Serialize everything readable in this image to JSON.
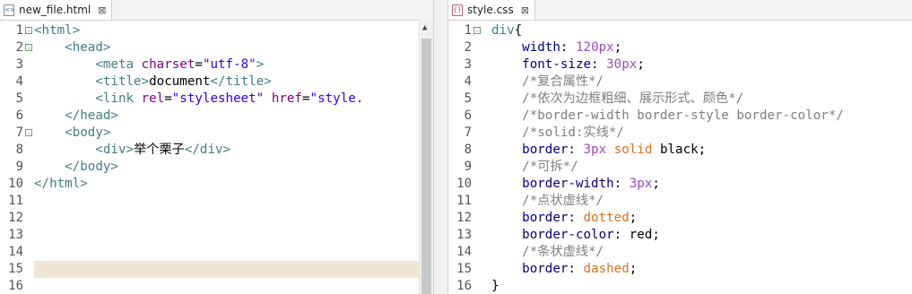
{
  "left_pane": {
    "tab_label": "new_file.html",
    "tab_icon": "html-file-icon",
    "close_glyph": "⊠",
    "line_numbers": [
      "1",
      "2",
      "3",
      "4",
      "5",
      "6",
      "7",
      "8",
      "9",
      "10",
      "11",
      "12",
      "13",
      "14",
      "15",
      "16"
    ],
    "fold_markers": {
      "1": "⊟",
      "2": "⊟",
      "7": "⊟"
    },
    "current_line": 15,
    "lines": [
      [
        [
          "tag",
          "<html>"
        ]
      ],
      [
        [
          "plain",
          "    "
        ],
        [
          "tag",
          "<head>"
        ]
      ],
      [
        [
          "plain",
          "        "
        ],
        [
          "tag",
          "<meta "
        ],
        [
          "attr",
          "charset"
        ],
        [
          "plain",
          "="
        ],
        [
          "str",
          "\"utf-8\""
        ],
        [
          "tag",
          ">"
        ]
      ],
      [
        [
          "plain",
          "        "
        ],
        [
          "tag",
          "<title>"
        ],
        [
          "plain",
          "document"
        ],
        [
          "tag",
          "</title>"
        ]
      ],
      [
        [
          "plain",
          "        "
        ],
        [
          "tag",
          "<link "
        ],
        [
          "attr",
          "rel"
        ],
        [
          "plain",
          "="
        ],
        [
          "str",
          "\"stylesheet\""
        ],
        [
          "plain",
          " "
        ],
        [
          "attr",
          "href"
        ],
        [
          "plain",
          "="
        ],
        [
          "str",
          "\"style."
        ]
      ],
      [
        [
          "plain",
          "    "
        ],
        [
          "tag",
          "</head>"
        ]
      ],
      [
        [
          "plain",
          "    "
        ],
        [
          "tag",
          "<body>"
        ]
      ],
      [
        [
          "plain",
          "        "
        ],
        [
          "tag",
          "<div>"
        ],
        [
          "plain",
          "举个栗子"
        ],
        [
          "tag",
          "</div>"
        ]
      ],
      [
        [
          "plain",
          "    "
        ],
        [
          "tag",
          "</body>"
        ]
      ],
      [
        [
          "tag",
          "</html>"
        ]
      ],
      [],
      [],
      [],
      [],
      [],
      []
    ]
  },
  "right_pane": {
    "tab_label": "style.css",
    "tab_icon": "css-file-icon",
    "close_glyph": "⊠",
    "line_numbers": [
      "1",
      "2",
      "3",
      "4",
      "5",
      "6",
      "7",
      "8",
      "9",
      "10",
      "11",
      "12",
      "13",
      "14",
      "15",
      "16"
    ],
    "fold_markers": {
      "1": "⊟"
    },
    "lines": [
      [
        [
          "sel",
          "div"
        ],
        [
          "plain",
          "{"
        ]
      ],
      [
        [
          "plain",
          "    "
        ],
        [
          "prop",
          "width"
        ],
        [
          "plain",
          ": "
        ],
        [
          "num",
          "120px"
        ],
        [
          "plain",
          ";"
        ]
      ],
      [
        [
          "plain",
          "    "
        ],
        [
          "prop",
          "font-size"
        ],
        [
          "plain",
          ": "
        ],
        [
          "num",
          "30px"
        ],
        [
          "plain",
          ";"
        ]
      ],
      [
        [
          "plain",
          "    "
        ],
        [
          "cmt",
          "/*复合属性*/"
        ]
      ],
      [
        [
          "plain",
          "    "
        ],
        [
          "cmt",
          "/*依次为边框粗细、展示形式、颜色*/"
        ]
      ],
      [
        [
          "plain",
          "    "
        ],
        [
          "cmt",
          "/*border-width border-style border-color*/"
        ]
      ],
      [
        [
          "plain",
          "    "
        ],
        [
          "cmt",
          "/*solid:实线*/"
        ]
      ],
      [
        [
          "plain",
          "    "
        ],
        [
          "prop",
          "border"
        ],
        [
          "plain",
          ": "
        ],
        [
          "num",
          "3px"
        ],
        [
          "plain",
          " "
        ],
        [
          "kw",
          "solid"
        ],
        [
          "plain",
          " black;"
        ]
      ],
      [
        [
          "plain",
          "    "
        ],
        [
          "cmt",
          "/*可拆*/"
        ]
      ],
      [
        [
          "plain",
          "    "
        ],
        [
          "prop",
          "border-width"
        ],
        [
          "plain",
          ": "
        ],
        [
          "num",
          "3px"
        ],
        [
          "plain",
          ";"
        ]
      ],
      [
        [
          "plain",
          "    "
        ],
        [
          "cmt",
          "/*点状虚线*/"
        ]
      ],
      [
        [
          "plain",
          "    "
        ],
        [
          "prop",
          "border"
        ],
        [
          "plain",
          ": "
        ],
        [
          "kw",
          "dotted"
        ],
        [
          "plain",
          ";"
        ]
      ],
      [
        [
          "plain",
          "    "
        ],
        [
          "prop",
          "border-color"
        ],
        [
          "plain",
          ": red;"
        ]
      ],
      [
        [
          "plain",
          "    "
        ],
        [
          "cmt",
          "/*条状虚线*/"
        ]
      ],
      [
        [
          "plain",
          "    "
        ],
        [
          "prop",
          "border"
        ],
        [
          "plain",
          ": "
        ],
        [
          "kw",
          "dashed"
        ],
        [
          "plain",
          ";"
        ]
      ],
      [
        [
          "plain",
          "}"
        ]
      ]
    ]
  }
}
